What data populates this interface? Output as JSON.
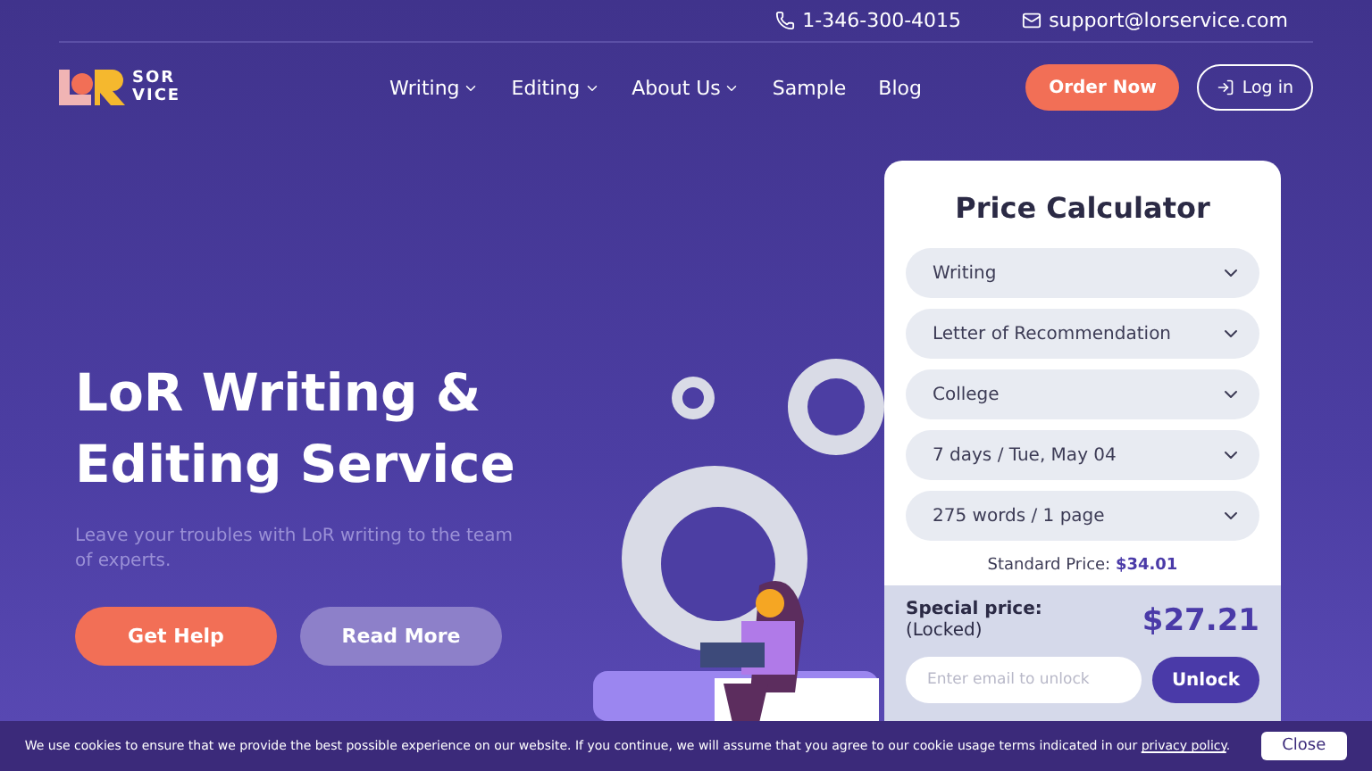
{
  "topbar": {
    "phone": "1-346-300-4015",
    "email": "support@lorservice.com"
  },
  "logo": {
    "line1": "SOR",
    "line2": "VICE"
  },
  "nav": [
    {
      "label": "Writing",
      "dropdown": true
    },
    {
      "label": "Editing",
      "dropdown": true
    },
    {
      "label": "About Us",
      "dropdown": true
    },
    {
      "label": "Sample",
      "dropdown": false
    },
    {
      "label": "Blog",
      "dropdown": false
    }
  ],
  "order_button": "Order Now",
  "login_button": "Log in",
  "hero": {
    "title": "LoR Writing & Editing Service",
    "subtitle": "Leave your troubles with LoR writing to the team of experts.",
    "buttons": [
      "Get Help",
      "Read More"
    ]
  },
  "calculator": {
    "title": "Price Calculator",
    "selects": [
      "Writing",
      "Letter of Recommendation",
      "College",
      "7 days / Tue, May 04",
      "275 words / 1 page"
    ],
    "standard_label": "Standard Price:",
    "standard_price": "$34.01",
    "special_label": "Special price:",
    "special_state": "(Locked)",
    "special_price": "$27.21",
    "email_placeholder": "Enter email to unlock",
    "unlock_button": "Unlock"
  },
  "cookie": {
    "text": "We use cookies to ensure that we provide the best possible experience on our website. If you continue, we will assume that you agree to our cookie usage terms indicated in our",
    "link": "privacy policy",
    "after": ".",
    "button": "Close"
  }
}
